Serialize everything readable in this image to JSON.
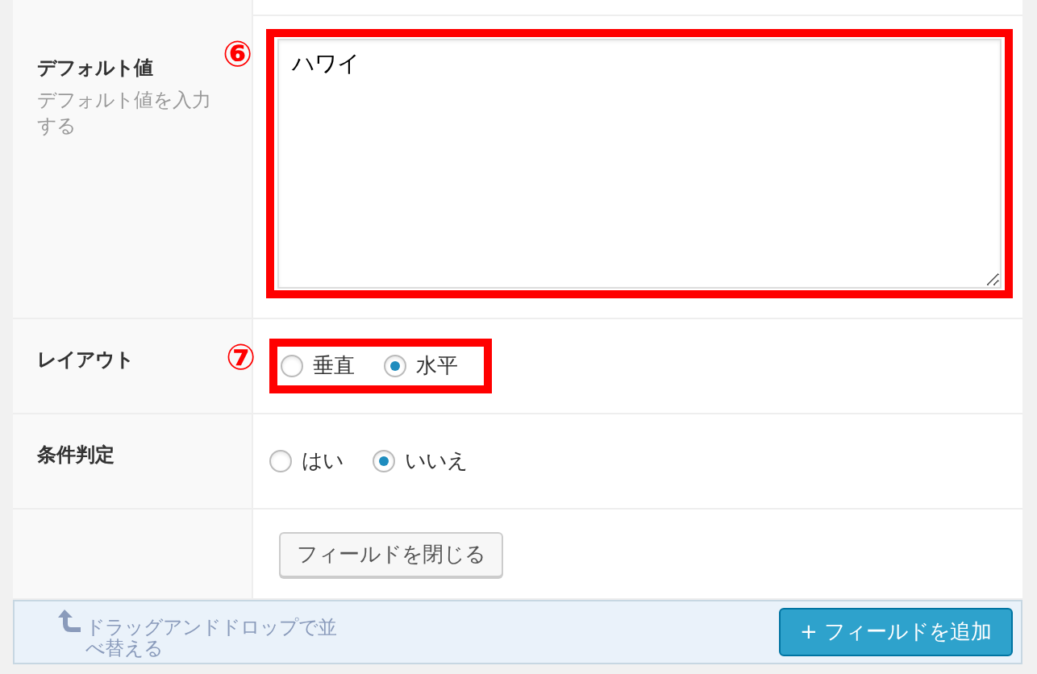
{
  "rows": [
    {
      "kind": "textarea",
      "label": "デフォルト値",
      "description": "デフォルト値を入力する",
      "annotation": "⑥",
      "value": "ハワイ"
    },
    {
      "kind": "radio",
      "label": "レイアウト",
      "annotation": "⑦",
      "options": [
        {
          "label": "垂直",
          "selected": false
        },
        {
          "label": "水平",
          "selected": true
        }
      ]
    },
    {
      "kind": "radio",
      "label": "条件判定",
      "options": [
        {
          "label": "はい",
          "selected": false
        },
        {
          "label": "いいえ",
          "selected": true
        }
      ]
    },
    {
      "kind": "button",
      "button": "フィールドを閉じる"
    }
  ],
  "footer": {
    "hint": "ドラッグアンドドロップで並べ替える",
    "add_button": "+ フィールドを追加"
  }
}
